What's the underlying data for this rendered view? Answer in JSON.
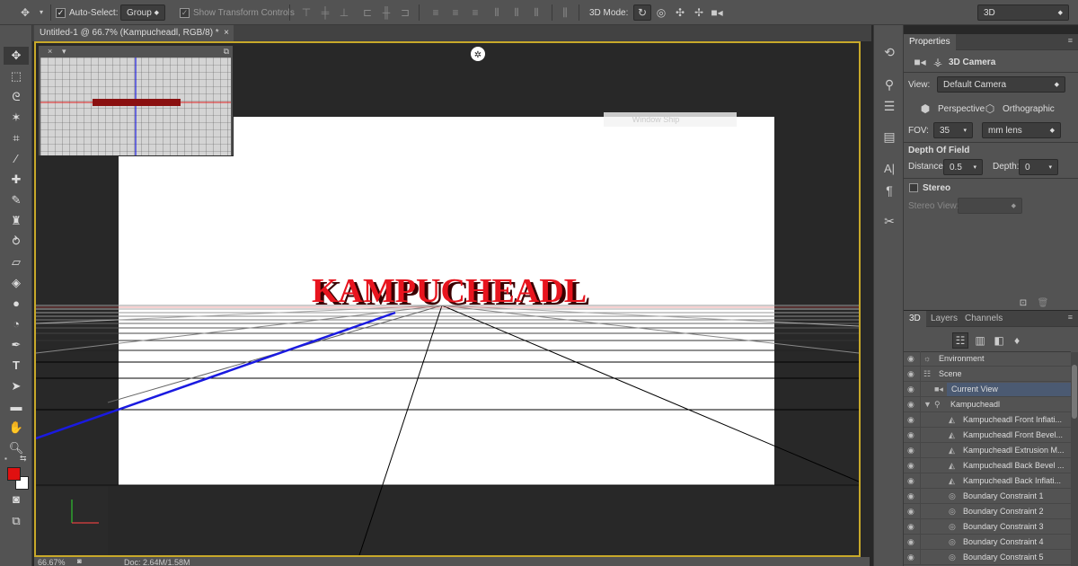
{
  "options_bar": {
    "auto_select_label": "Auto-Select:",
    "auto_select_value": "Group",
    "show_transform_label": "Show Transform Controls",
    "mode_label": "3D Mode:",
    "workspace_value": "3D"
  },
  "document": {
    "tab_title": "Untitled-1 @ 66.7% (Kampucheadl, RGB/8) *",
    "text_object": "KAMPUCHEADL",
    "hint_text": "Window Ship"
  },
  "properties": {
    "tab": "Properties",
    "header": "3D Camera",
    "view_label": "View:",
    "view_value": "Default Camera",
    "perspective": "Perspective",
    "orthographic": "Orthographic",
    "fov_label": "FOV:",
    "fov_value": "35",
    "lens_value": "mm lens",
    "dof_label": "Depth Of Field",
    "distance_label": "Distance:",
    "distance_value": "0.5",
    "depth_label": "Depth:",
    "depth_value": "0",
    "stereo_label": "Stereo",
    "stereo_view_label": "Stereo View:"
  },
  "layers_panel": {
    "tabs": [
      "3D",
      "Layers",
      "Channels"
    ],
    "items": [
      {
        "label": "Environment"
      },
      {
        "label": "Scene"
      },
      {
        "label": "Current View"
      },
      {
        "label": "Kampucheadl"
      },
      {
        "label": "Kampucheadl Front Inflati..."
      },
      {
        "label": "Kampucheadl Front Bevel..."
      },
      {
        "label": "Kampucheadl Extrusion M..."
      },
      {
        "label": "Kampucheadl Back Bevel ..."
      },
      {
        "label": "Kampucheadl Back Inflati..."
      },
      {
        "label": "Boundary Constraint 1"
      },
      {
        "label": "Boundary Constraint 2"
      },
      {
        "label": "Boundary Constraint 3"
      },
      {
        "label": "Boundary Constraint 4"
      },
      {
        "label": "Boundary Constraint 5"
      }
    ]
  },
  "status_bar": {
    "zoom": "66.67%",
    "doc": "Doc: 2.64M/1.58M"
  },
  "colors": {
    "foreground": "#e01010",
    "background": "#ffffff",
    "accent_border": "#c8a92a",
    "text_red": "#e8141e"
  }
}
